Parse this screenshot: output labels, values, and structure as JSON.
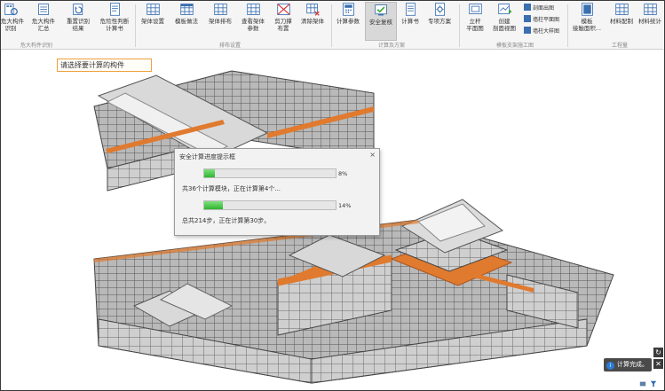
{
  "ribbon": {
    "buttons": [
      {
        "label": "危大构件\n识别",
        "icon": "building-scan-icon"
      },
      {
        "label": "危大构件\n汇总",
        "icon": "building-summary-icon"
      },
      {
        "label": "重置识别\n结果",
        "icon": "building-reset-icon"
      },
      {
        "label": "危险性判断\n计算书",
        "icon": "building-report-icon"
      },
      {
        "label": "架体设置",
        "icon": "frame-settings-icon"
      },
      {
        "label": "模板做法",
        "icon": "formwork-method-icon"
      },
      {
        "label": "架体排布",
        "icon": "frame-layout-icon"
      },
      {
        "label": "查看架体\n参数",
        "icon": "frame-params-icon"
      },
      {
        "label": "剪刀撑\n布置",
        "icon": "scissor-brace-icon"
      },
      {
        "label": "清除架体",
        "icon": "clear-frame-icon"
      },
      {
        "label": "计算参数",
        "icon": "calc-params-icon"
      },
      {
        "label": "安全复核",
        "icon": "safety-check-icon"
      },
      {
        "label": "计算书",
        "icon": "calc-report-icon"
      },
      {
        "label": "专项方案",
        "icon": "special-plan-icon"
      },
      {
        "label": "立杆\n平面图",
        "icon": "pole-plan-icon"
      },
      {
        "label": "创建\n剖面视图",
        "icon": "section-view-icon"
      },
      {
        "label": "模板\n接触面积...",
        "icon": "contact-area-icon"
      },
      {
        "label": "材料配制",
        "icon": "material-config-icon"
      },
      {
        "label": "材料统计",
        "icon": "material-stats-icon"
      }
    ],
    "small_buttons": [
      {
        "label": "剖面出图",
        "icon": "section-drawing-icon"
      },
      {
        "label": "墙柱平面图",
        "icon": "wall-column-plan-icon"
      },
      {
        "label": "墙柱大样图",
        "icon": "wall-column-detail-icon"
      }
    ],
    "groups": [
      "危大构件识别",
      "排布设置",
      "计算及方案",
      "模板支架施工图",
      "工程量"
    ]
  },
  "prompt_text": "请选择要计算的构件",
  "dialog": {
    "title": "安全计算进度提示框",
    "close_glyph": "×",
    "progress1": {
      "value": 0.08,
      "text": "8%"
    },
    "line1": "共36个计算模块，正在计算第4个...",
    "progress2": {
      "value": 0.14,
      "text": "14%"
    },
    "line2": "总共214步，正在计算第30步。"
  },
  "toast": {
    "text": "计算完成。",
    "icon_glyph": "i"
  },
  "side_buttons": [
    "↻",
    "✕"
  ],
  "colors": {
    "accent_orange": "#e07a2e",
    "progress_green": "#2fb52f",
    "toast_bg": "#4a4a4a"
  }
}
